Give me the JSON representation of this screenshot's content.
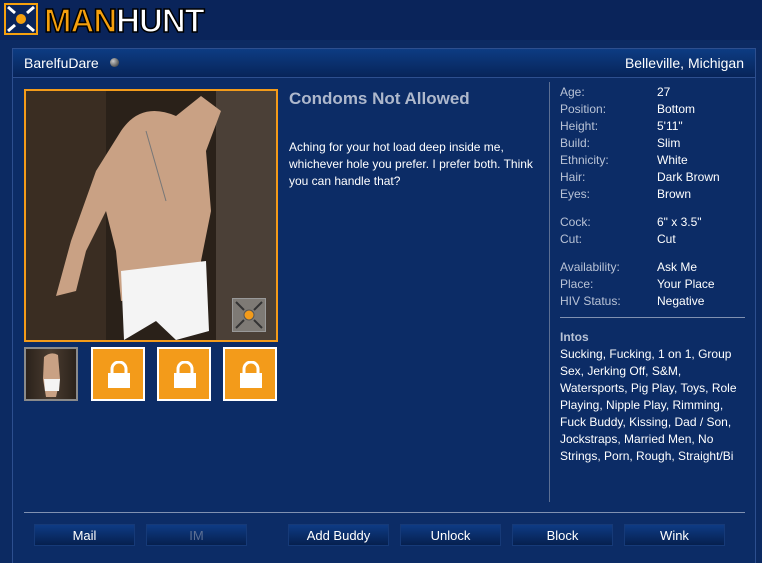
{
  "brand": {
    "logo_prefix": "MAN",
    "logo_suffix": "HUNT"
  },
  "profile": {
    "username": "BarelfuDare",
    "location": "Belleville, Michigan",
    "headline": "Condoms Not Allowed",
    "description": "Aching for your hot load deep inside me, whichever hole you prefer. I prefer both. Think you can handle that?"
  },
  "stats": [
    {
      "key": "Age:",
      "value": "27"
    },
    {
      "key": "Position:",
      "value": "Bottom"
    },
    {
      "key": "Height:",
      "value": "5'11\""
    },
    {
      "key": "Build:",
      "value": "Slim"
    },
    {
      "key": "Ethnicity:",
      "value": "White"
    },
    {
      "key": "Hair:",
      "value": "Dark Brown"
    },
    {
      "key": "Eyes:",
      "value": "Brown"
    },
    {
      "key": "Cock:",
      "value": "6\" x 3.5\""
    },
    {
      "key": "Cut:",
      "value": "Cut"
    },
    {
      "key": "Availability:",
      "value": "Ask Me"
    },
    {
      "key": "Place:",
      "value": "Your Place"
    },
    {
      "key": "HIV Status:",
      "value": "Negative"
    }
  ],
  "intos": {
    "label": "Intos",
    "text": "Sucking, Fucking, 1 on 1, Group Sex, Jerking Off, S&M, Watersports, Pig Play, Toys, Role Playing, Nipple Play, Rimming, Fuck Buddy, Kissing, Dad / Son, Jockstraps, Married Men, No Strings, Porn, Rough, Straight/Bi"
  },
  "actions": {
    "mail": "Mail",
    "im": "IM",
    "add_buddy": "Add Buddy",
    "unlock": "Unlock",
    "block": "Block",
    "wink": "Wink"
  },
  "colors": {
    "accent": "#f39b1a",
    "background": "#0c2a62",
    "header": "#0d3c83"
  },
  "icons": [
    "manhunt-logo-icon",
    "status-dot-icon",
    "zoom-icon",
    "lock-icon"
  ]
}
